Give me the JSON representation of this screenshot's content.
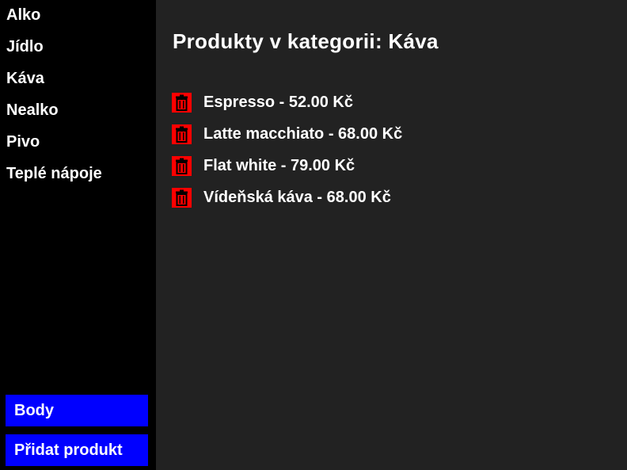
{
  "sidebar": {
    "categories": [
      {
        "label": "Alko"
      },
      {
        "label": "Jídlo"
      },
      {
        "label": "Káva"
      },
      {
        "label": "Nealko"
      },
      {
        "label": "Pivo"
      },
      {
        "label": "Teplé nápoje"
      }
    ],
    "body_button": "Body",
    "add_product_button": "Přidat produkt"
  },
  "main": {
    "title": "Produkty v kategorii: Káva",
    "products": [
      {
        "text": "Espresso - 52.00 Kč",
        "delete_icon": "trash-icon"
      },
      {
        "text": "Latte macchiato - 68.00 Kč",
        "delete_icon": "trash-icon"
      },
      {
        "text": "Flat white - 79.00 Kč",
        "delete_icon": "trash-icon"
      },
      {
        "text": "Vídeňská káva - 68.00 Kč",
        "delete_icon": "trash-icon"
      }
    ]
  },
  "colors": {
    "sidebar_bg": "#000000",
    "main_bg": "#222222",
    "button_bg": "#0000ff",
    "delete_bg": "#ff0000",
    "text": "#ffffff"
  }
}
